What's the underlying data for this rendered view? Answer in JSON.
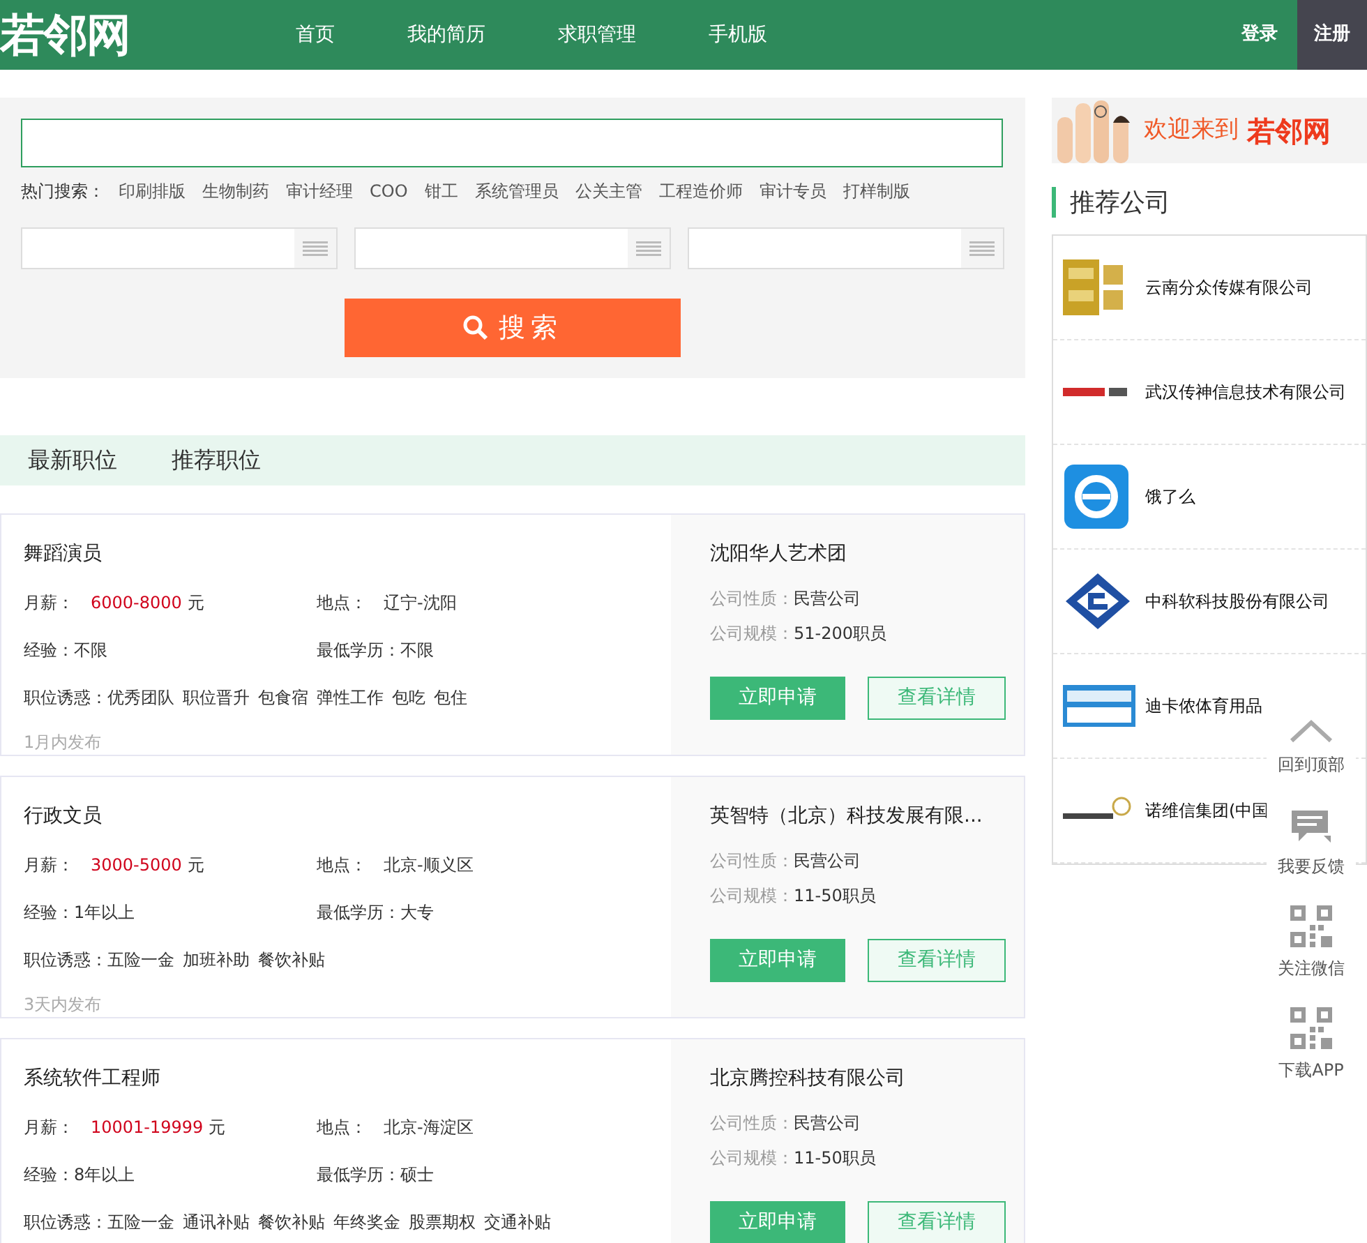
{
  "header": {
    "logo": "若邻网",
    "nav": [
      "首页",
      "我的简历",
      "求职管理",
      "手机版"
    ],
    "login": "登录",
    "register": "注册"
  },
  "search": {
    "hot_label": "热门搜索：",
    "hot_terms": [
      "印刷排版",
      "生物制药",
      "审计经理",
      "COO",
      "钳工",
      "系统管理员",
      "公关主管",
      "工程造价师",
      "审计专员",
      "打样制版"
    ],
    "button": "搜索"
  },
  "tabs": [
    "最新职位",
    "推荐职位"
  ],
  "jobs": [
    {
      "title": "舞蹈演员",
      "salary_label": "月薪：",
      "salary": "6000-8000",
      "unit": "元",
      "location_label": "地点：",
      "location": "辽宁-沈阳",
      "exp": "经验：不限",
      "edu": "最低学历：不限",
      "perks_label": "职位诱惑：",
      "perks": [
        "优秀团队",
        "职位晋升",
        "包食宿",
        "弹性工作",
        "包吃",
        "包住"
      ],
      "posted": "1月内发布",
      "company": "沈阳华人艺术团",
      "nature_label": "公司性质：",
      "nature": "民营公司",
      "size_label": "公司规模：",
      "size": "51-200职员",
      "apply": "立即申请",
      "details": "查看详情"
    },
    {
      "title": "行政文员",
      "salary_label": "月薪：",
      "salary": "3000-5000",
      "unit": "元",
      "location_label": "地点：",
      "location": "北京-顺义区",
      "exp": "经验：1年以上",
      "edu": "最低学历：大专",
      "perks_label": "职位诱惑：",
      "perks": [
        "五险一金",
        "加班补助",
        "餐饮补贴"
      ],
      "posted": "3天内发布",
      "company": "英智特（北京）科技发展有限...",
      "nature_label": "公司性质：",
      "nature": "民营公司",
      "size_label": "公司规模：",
      "size": "11-50职员",
      "apply": "立即申请",
      "details": "查看详情"
    },
    {
      "title": "系统软件工程师",
      "salary_label": "月薪：",
      "salary": "10001-19999",
      "unit": "元",
      "location_label": "地点：",
      "location": "北京-海淀区",
      "exp": "经验：8年以上",
      "edu": "最低学历：硕士",
      "perks_label": "职位诱惑：",
      "perks": [
        "五险一金",
        "通讯补贴",
        "餐饮补贴",
        "年终奖金",
        "股票期权",
        "交通补贴"
      ],
      "company": "北京腾控科技有限公司",
      "nature_label": "公司性质：",
      "nature": "民营公司",
      "size_label": "公司规模：",
      "size": "11-50职员",
      "apply": "立即申请",
      "details": "查看详情"
    }
  ],
  "banner": {
    "text": "欢迎来到",
    "brand": "若邻网"
  },
  "recommended": {
    "title": "推荐公司",
    "companies": [
      {
        "name": "云南分众传媒有限公司",
        "kind": "gold"
      },
      {
        "name": "武汉传神信息技术有限公司",
        "kind": "red"
      },
      {
        "name": "饿了么",
        "kind": "blue"
      },
      {
        "name": "中科软科技股份有限公司",
        "kind": "navy"
      },
      {
        "name": "迪卡侬体育用品",
        "kind": "sky"
      },
      {
        "name": "诺维信集团(中国",
        "kind": "plain"
      }
    ]
  },
  "toolbar": [
    {
      "kind": "top",
      "label": "回到顶部"
    },
    {
      "kind": "feedback",
      "label": "我要反馈"
    },
    {
      "kind": "qr",
      "label": "关注微信"
    },
    {
      "kind": "qr",
      "label": "下载APP"
    }
  ]
}
